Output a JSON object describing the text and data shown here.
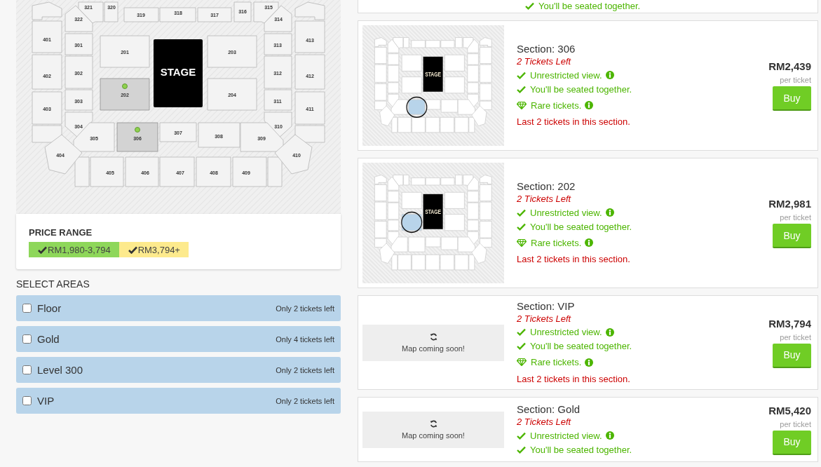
{
  "seat_map": {
    "stage_label": "STAGE",
    "sections": [
      {
        "label": "321",
        "selected": false
      },
      {
        "label": "320",
        "selected": false
      },
      {
        "label": "319",
        "selected": false
      },
      {
        "label": "318",
        "selected": false
      },
      {
        "label": "317",
        "selected": false
      },
      {
        "label": "316",
        "selected": false
      },
      {
        "label": "315",
        "selected": false
      },
      {
        "label": "322",
        "selected": false
      },
      {
        "label": "314",
        "selected": false
      },
      {
        "label": "401",
        "selected": false
      },
      {
        "label": "301",
        "selected": false
      },
      {
        "label": "201",
        "selected": false
      },
      {
        "label": "203",
        "selected": false
      },
      {
        "label": "313",
        "selected": false
      },
      {
        "label": "413",
        "selected": false
      },
      {
        "label": "302",
        "selected": false
      },
      {
        "label": "312",
        "selected": false
      },
      {
        "label": "402",
        "selected": false
      },
      {
        "label": "412",
        "selected": false
      },
      {
        "label": "202",
        "selected": true
      },
      {
        "label": "204",
        "selected": false
      },
      {
        "label": "303",
        "selected": false
      },
      {
        "label": "311",
        "selected": false
      },
      {
        "label": "403",
        "selected": false
      },
      {
        "label": "411",
        "selected": false
      },
      {
        "label": "304",
        "selected": false
      },
      {
        "label": "310",
        "selected": false
      },
      {
        "label": "305",
        "selected": false
      },
      {
        "label": "306",
        "selected": true
      },
      {
        "label": "307",
        "selected": false
      },
      {
        "label": "308",
        "selected": false
      },
      {
        "label": "309",
        "selected": false
      },
      {
        "label": "404",
        "selected": false
      },
      {
        "label": "410",
        "selected": false
      },
      {
        "label": "405",
        "selected": false
      },
      {
        "label": "406",
        "selected": false
      },
      {
        "label": "407",
        "selected": false
      },
      {
        "label": "408",
        "selected": false
      },
      {
        "label": "409",
        "selected": false
      }
    ]
  },
  "price_range": {
    "title": "PRICE RANGE",
    "ranges": [
      {
        "label": "RM1,980-3,794",
        "checked": true,
        "color": "#8ed75a"
      },
      {
        "label": "RM3,794+",
        "checked": true,
        "color": "#fdea8d"
      }
    ]
  },
  "select_areas": {
    "title": "SELECT AREAS",
    "areas": [
      {
        "name": "Floor",
        "availability": "Only 2 tickets left",
        "checked": false
      },
      {
        "name": "Gold",
        "availability": "Only 4 tickets left",
        "checked": false
      },
      {
        "name": "Level 300",
        "availability": "Only 2 tickets left",
        "checked": false
      },
      {
        "name": "VIP",
        "availability": "Only 2 tickets left",
        "checked": false
      }
    ]
  },
  "listings": [
    {
      "features": [
        {
          "kind": "check",
          "text": "You'll be seated together.",
          "info": false
        }
      ]
    },
    {
      "map": {
        "kind": "seat-map",
        "stage_label": "STAGE",
        "sections": [
          {
            "selected": false
          },
          {
            "selected": false
          },
          {
            "selected": false
          },
          {
            "selected": false
          },
          {
            "selected": false
          },
          {
            "selected": false
          },
          {
            "selected": false
          },
          {
            "selected": false
          },
          {
            "selected": false
          },
          {
            "selected": false
          },
          {
            "selected": false
          },
          {
            "selected": false
          },
          {
            "selected": false
          },
          {
            "selected": false
          },
          {
            "selected": false
          },
          {
            "selected": false
          },
          {
            "selected": false
          },
          {
            "selected": false
          },
          {
            "selected": false
          },
          {
            "selected": false
          },
          {
            "selected": false
          },
          {
            "selected": false
          },
          {
            "selected": false
          },
          {
            "selected": false
          },
          {
            "selected": false
          },
          {
            "selected": false
          },
          {
            "selected": false
          },
          {
            "selected": false
          },
          {
            "selected": true
          },
          {
            "selected": false
          },
          {
            "selected": false
          },
          {
            "selected": false
          },
          {
            "selected": false
          },
          {
            "selected": false
          },
          {
            "selected": false
          },
          {
            "selected": false
          },
          {
            "selected": false
          },
          {
            "selected": false
          },
          {
            "selected": false
          }
        ]
      },
      "section": "Section: 306",
      "tickets_left": "2 Tickets Left",
      "features": [
        {
          "kind": "check",
          "text": "Unrestricted view.",
          "info": true
        },
        {
          "kind": "check",
          "text": "You'll be seated together.",
          "info": false
        },
        {
          "kind": "rare",
          "text": "Rare tickets.",
          "info": true
        }
      ],
      "warning": "Last 2 tickets in this section.",
      "price": "RM2,439",
      "price_unit": "per ticket",
      "buy_label": "Buy"
    },
    {
      "map": {
        "kind": "seat-map",
        "stage_label": "STAGE",
        "sections": [
          {
            "selected": false
          },
          {
            "selected": false
          },
          {
            "selected": false
          },
          {
            "selected": false
          },
          {
            "selected": false
          },
          {
            "selected": false
          },
          {
            "selected": false
          },
          {
            "selected": false
          },
          {
            "selected": false
          },
          {
            "selected": false
          },
          {
            "selected": false
          },
          {
            "selected": false
          },
          {
            "selected": false
          },
          {
            "selected": false
          },
          {
            "selected": false
          },
          {
            "selected": false
          },
          {
            "selected": false
          },
          {
            "selected": false
          },
          {
            "selected": false
          },
          {
            "selected": true
          },
          {
            "selected": false
          },
          {
            "selected": false
          },
          {
            "selected": false
          },
          {
            "selected": false
          },
          {
            "selected": false
          },
          {
            "selected": false
          },
          {
            "selected": false
          },
          {
            "selected": false
          },
          {
            "selected": false
          },
          {
            "selected": false
          },
          {
            "selected": false
          },
          {
            "selected": false
          },
          {
            "selected": false
          },
          {
            "selected": false
          },
          {
            "selected": false
          },
          {
            "selected": false
          },
          {
            "selected": false
          },
          {
            "selected": false
          },
          {
            "selected": false
          }
        ]
      },
      "section": "Section: 202",
      "tickets_left": "2 Tickets Left",
      "features": [
        {
          "kind": "check",
          "text": "Unrestricted view.",
          "info": true
        },
        {
          "kind": "check",
          "text": "You'll be seated together.",
          "info": false
        },
        {
          "kind": "rare",
          "text": "Rare tickets.",
          "info": true
        }
      ],
      "warning": "Last 2 tickets in this section.",
      "price": "RM2,981",
      "price_unit": "per ticket",
      "buy_label": "Buy"
    },
    {
      "map": {
        "kind": "placeholder",
        "message": "Map coming soon!"
      },
      "section": "Section: VIP",
      "tickets_left": "2 Tickets Left",
      "features": [
        {
          "kind": "check",
          "text": "Unrestricted view.",
          "info": true
        },
        {
          "kind": "check",
          "text": "You'll be seated together.",
          "info": false
        },
        {
          "kind": "rare",
          "text": "Rare tickets.",
          "info": true
        }
      ],
      "warning": "Last 2 tickets in this section.",
      "price": "RM3,794",
      "price_unit": "per ticket",
      "buy_label": "Buy"
    },
    {
      "map": {
        "kind": "placeholder",
        "message": "Map coming soon!"
      },
      "section": "Section: Gold",
      "tickets_left": "2 Tickets Left",
      "features": [
        {
          "kind": "check",
          "text": "Unrestricted view.",
          "info": true
        },
        {
          "kind": "check",
          "text": "You'll be seated together.",
          "info": false
        }
      ],
      "price": "RM5,420",
      "price_unit": "per ticket",
      "buy_label": "Buy"
    }
  ]
}
